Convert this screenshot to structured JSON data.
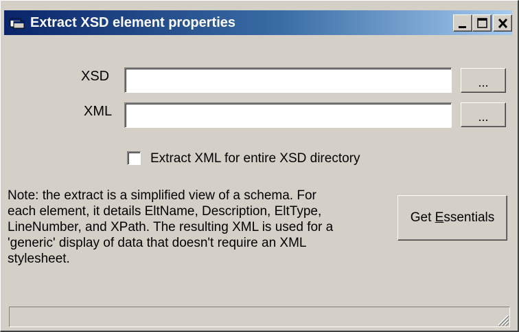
{
  "window": {
    "title": "Extract XSD element properties",
    "icon": "app-window-icon"
  },
  "form": {
    "xsd_label": "XSD",
    "xsd_value": "",
    "xsd_browse_label": "...",
    "xml_label": "XML",
    "xml_value": "",
    "xml_browse_label": "...",
    "checkbox_label": "Extract XML for entire XSD directory",
    "checkbox_checked": false,
    "note_lines": [
      "Note: the extract is a simplified view of a schema. For",
      "each element, it details EltName, Description, EltType,",
      "LineNumber, and XPath. The resulting XML is used for a",
      "'generic' display of data that doesn't require an XML",
      "stylesheet."
    ],
    "action_button": {
      "pre": "Get ",
      "accel": "E",
      "post": "ssentials"
    }
  },
  "status_bar": {
    "text": ""
  },
  "colors": {
    "face": "#d4d0c8",
    "title_start": "#0a246a",
    "title_end": "#a6caf0"
  }
}
